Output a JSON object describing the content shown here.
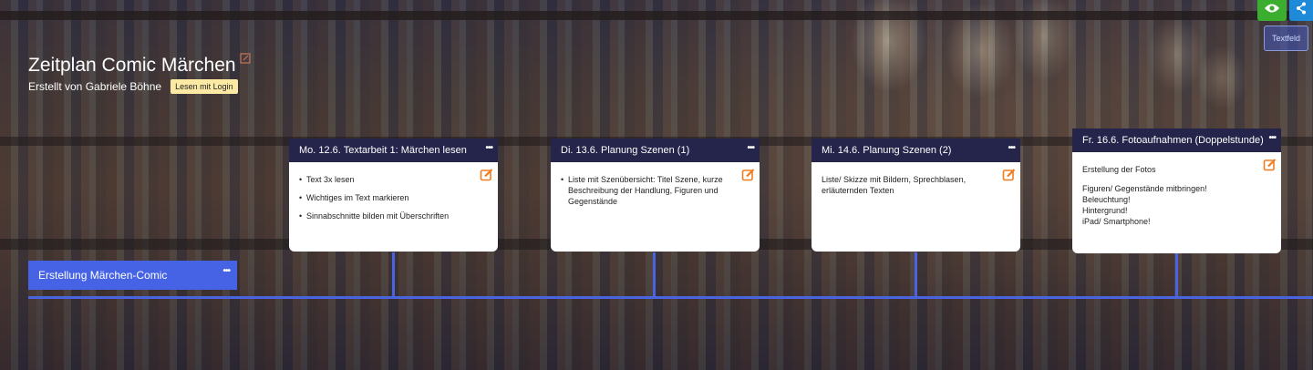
{
  "header": {
    "title": "Zeitplan Comic Märchen",
    "subtitle": "Erstellt von Gabriele Böhne",
    "login_badge": "Lesen mit Login"
  },
  "toolbar": {
    "textfeld_label": "Textfeld",
    "eye_icon": "eye-icon",
    "share_icon": "share-icon"
  },
  "main_node": {
    "label": "Erstellung Märchen-Comic",
    "menu": "•••"
  },
  "cards": [
    {
      "title": "Mo. 12.6. Textarbeit 1: Märchen lesen",
      "menu": "•••",
      "items": [
        "Text 3x lesen",
        "Wichtiges im Text markieren",
        "Sinnabschnitte bilden mit Überschriften"
      ]
    },
    {
      "title": "Di. 13.6. Planung Szenen (1)",
      "menu": "•••",
      "items": [
        "Liste mit Szenübersicht: Titel Szene, kurze Beschreibung der Handlung, Figuren und Gegenstände"
      ]
    },
    {
      "title": "Mi. 14.6. Planung Szenen (2)",
      "menu": "•••",
      "text": "Liste/ Skizze mit Bildern, Sprechblasen, erläuternden Texten"
    },
    {
      "title": "Fr. 16.6. Fotoaufnahmen (Doppelstunde)",
      "menu": "•••",
      "intro": "Erstellung der Fotos",
      "lines": [
        "Figuren/ Gegenstände mitbringen!",
        "Beleuchtung!",
        "Hintergrund!",
        "iPad/ Smartphone!"
      ]
    }
  ],
  "colors": {
    "timeline": "#4a63e0",
    "card_header": "#25244a",
    "edit_icon": "#f07c22",
    "eye_button": "#3cae2f",
    "share_button": "#1f8ad8"
  }
}
